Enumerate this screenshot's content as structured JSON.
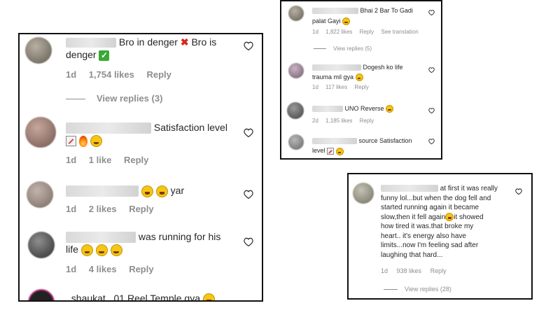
{
  "panel_a": {
    "comments": [
      {
        "text_pre": "Bro in denger",
        "text_mid": "Bro is",
        "text_post": "denger",
        "time": "1d",
        "likes": "1,754 likes",
        "reply": "Reply"
      },
      {
        "text": "Satisfaction level",
        "time": "1d",
        "likes": "1 like",
        "reply": "Reply"
      },
      {
        "text": "yar",
        "time": "1d",
        "likes": "2 likes",
        "reply": "Reply"
      },
      {
        "text_line1": "was running for his",
        "text_line2": "life",
        "time": "1d",
        "likes": "4 likes",
        "reply": "Reply"
      },
      {
        "partial_text": "_shaukat_ 01 Reel Temple gya"
      }
    ],
    "view_replies": "View replies (3)"
  },
  "panel_b": {
    "comments": [
      {
        "text_line1": "Bhai 2 Bar To Gadi",
        "text_line2": "palat Gayi",
        "time": "1d",
        "likes": "1,822 likes",
        "reply": "Reply",
        "translation": "See translation"
      },
      {
        "text_line1": "Dogesh ko life",
        "text_line2": "trauma mil gya",
        "time": "1d",
        "likes": "117 likes",
        "reply": "Reply"
      },
      {
        "text": "UNO Reverse",
        "time": "2d",
        "likes": "1,185 likes",
        "reply": "Reply"
      },
      {
        "text_line1": "source Satisfaction",
        "text_line2": "level"
      }
    ],
    "view_replies": "View replies (5)"
  },
  "panel_c": {
    "comment": {
      "lines": [
        "at first it was really",
        "funny lol...but when the dog fell and",
        "started running again it became",
        "slow,then it fell again",
        "it showed",
        "how tired it was.that broke my",
        "heart.. it's energy also have",
        "limits...now I'm feeling sad after",
        "laughing that hard..."
      ],
      "time": "1d",
      "likes": "938 likes",
      "reply": "Reply"
    },
    "view_replies": "View replies (28)"
  },
  "icons": {
    "heart": "heart-outline-icon"
  },
  "colors": {
    "meta_gray": "#8e8e8e",
    "text": "#262626",
    "border": "#111111"
  }
}
